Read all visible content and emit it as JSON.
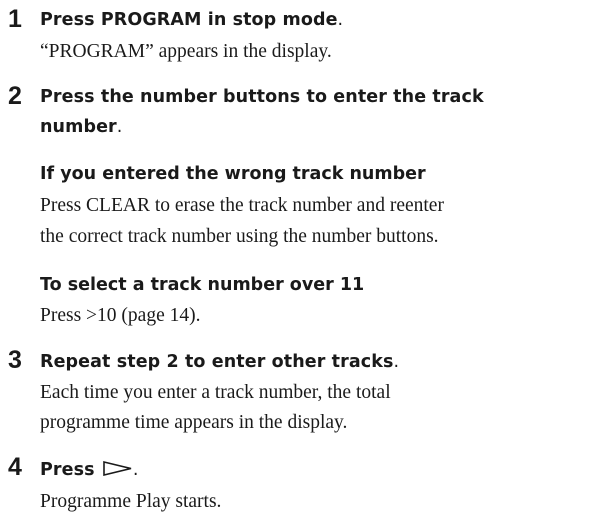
{
  "steps": [
    {
      "number": "1",
      "heading": "Press PROGRAM in stop mode",
      "heading_end": ".",
      "text": "“PROGRAM” appears in the display."
    },
    {
      "number": "2",
      "heading_line1": "Press the number buttons to enter the track",
      "heading_line2": "number",
      "heading_end": ".",
      "notes": [
        {
          "title": "If you entered the wrong track number",
          "line1": "Press CLEAR to erase the track number and reenter",
          "line2": "the correct track number using the number buttons."
        },
        {
          "title": "To select a track number over 11",
          "line1": "Press >10 (page 14)."
        }
      ]
    },
    {
      "number": "3",
      "heading": "Repeat step 2 to enter other tracks",
      "heading_end": ".",
      "line1": "Each time you enter a track number, the total",
      "line2": "programme time appears in the display."
    },
    {
      "number": "4",
      "heading": "Press",
      "heading_end": ".",
      "icon": "play-icon",
      "text": "Programme Play starts."
    }
  ]
}
